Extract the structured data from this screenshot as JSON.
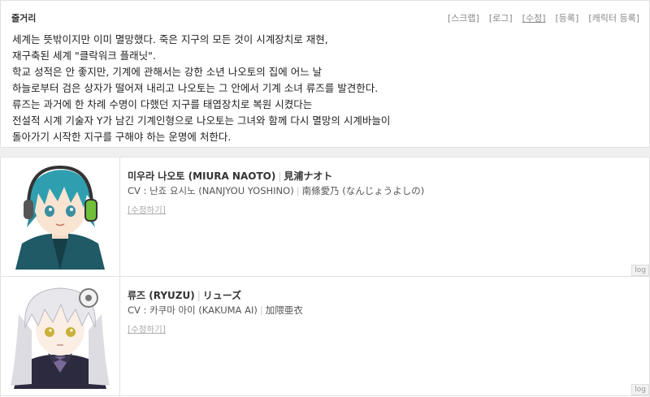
{
  "synopsis": {
    "title": "줄거리",
    "links": [
      "[스크랩]",
      "[로그]",
      "[수정]",
      "[등록]",
      "[캐릭터 등록]"
    ],
    "lines": [
      "세계는 뜻밖이지만 이미 멸망했다. 죽은 지구의 모든 것이 시계장치로 재현,",
      "재구축된 세계 \"클락워크 플래닛\".",
      "학교 성적은 안 좋지만, 기계에 관해서는 강한 소년 나오토의 집에 어느 날",
      "하늘로부터 검은 상자가 떨어져 내리고 나오토는 그 안에서 기계 소녀 류즈를 발견한다.",
      "류즈는 과거에 한 차례 수명이 다했던 지구를 태엽장치로 복원 시켰다는",
      "전설적 시계 기술자 Y가 남긴 기계인형으로 나오토는 그녀와 함께 다시 멸망의 시계바늘이",
      "돌아가기 시작한 지구를 구해야 하는 운명에 처한다."
    ]
  },
  "characters": [
    {
      "name_ko": "미우라 나오토 (MIURA NAOTO)",
      "name_jp": "見浦ナオト",
      "cv_ko": "CV : 난죠 요시노 (NANJYOU YOSHINO)",
      "cv_jp": "南條愛乃 (なんじょうよしの)",
      "edit": "[수정하기]",
      "log": "log"
    },
    {
      "name_ko": "류즈 (RYUZU)",
      "name_jp": "リューズ",
      "cv_ko": "CV : 카쿠마 아이 (KAKUMA AI)",
      "cv_jp": "加隈亜衣",
      "edit": "[수정하기]",
      "log": "log"
    }
  ],
  "colors": {
    "naoto_hair": "#2f9fb0",
    "naoto_jacket": "#1f5a66",
    "naoto_headphone": "#6fbf3a",
    "ryuzu_hair": "#e8e8ec",
    "ryuzu_dress": "#2c2a3e"
  }
}
